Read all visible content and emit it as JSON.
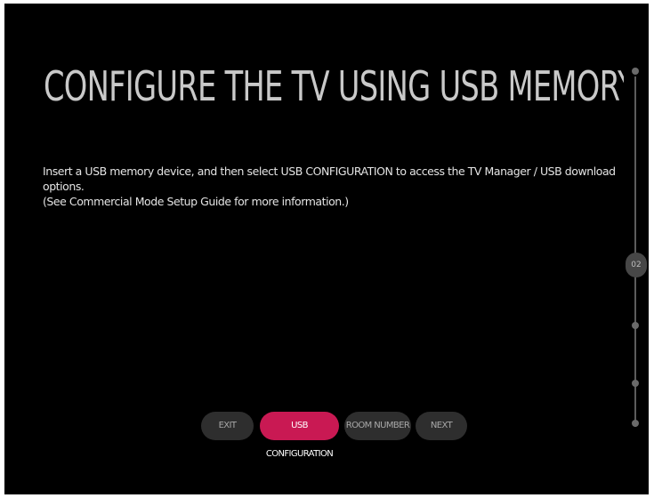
{
  "screen": {
    "title": "CONFIGURE THE TV USING USB MEMORY D",
    "description_lines": [
      "Insert a USB memory device, and then select USB CONFIGURATION to access the TV Manager / USB download options.",
      "(See Commercial Mode Setup Guide for more information.)"
    ]
  },
  "progress": {
    "current_step_label": "02"
  },
  "buttons": {
    "exit": "EXIT",
    "usb_configuration": "USB CONFIGURATION",
    "room_number": "ROOM NUMBER",
    "next": "NEXT"
  },
  "colors": {
    "background": "#000000",
    "accent": "#c91953",
    "button": "#2e2e2e",
    "title_text": "#c9c9c9"
  }
}
